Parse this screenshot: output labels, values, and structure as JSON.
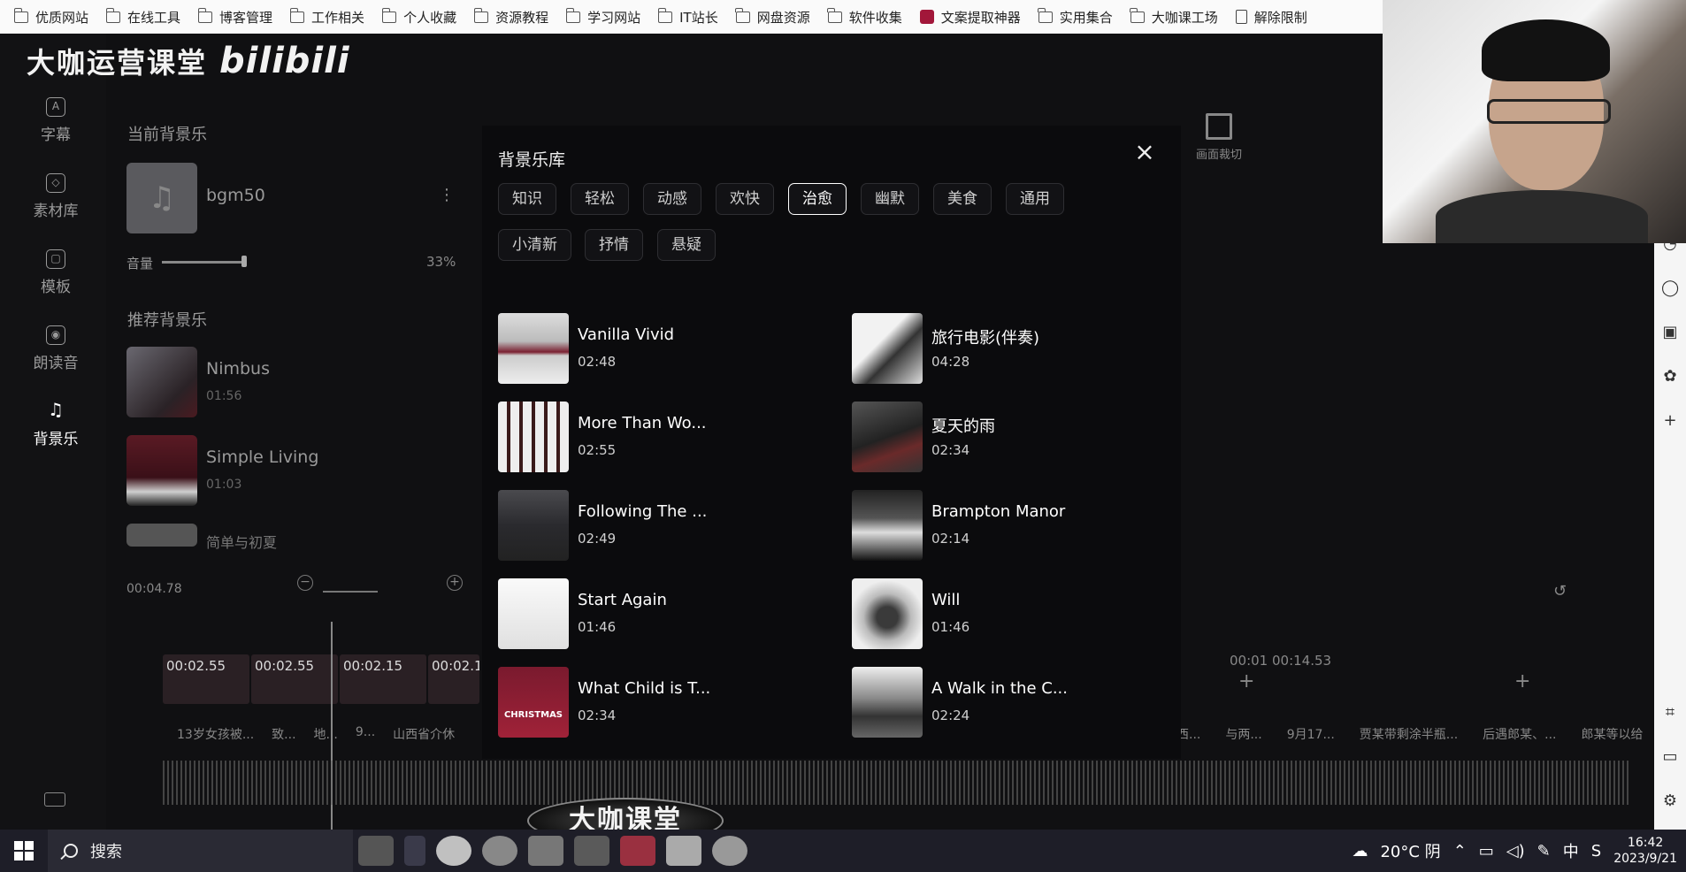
{
  "bookmarks": [
    {
      "label": "优质网站",
      "icon": "folder-icon"
    },
    {
      "label": "在线工具",
      "icon": "folder-icon"
    },
    {
      "label": "博客管理",
      "icon": "folder-icon"
    },
    {
      "label": "工作相关",
      "icon": "folder-icon"
    },
    {
      "label": "个人收藏",
      "icon": "folder-icon"
    },
    {
      "label": "资源教程",
      "icon": "folder-icon"
    },
    {
      "label": "学习网站",
      "icon": "folder-icon"
    },
    {
      "label": "IT站长",
      "icon": "folder-icon"
    },
    {
      "label": "网盘资源",
      "icon": "folder-icon"
    },
    {
      "label": "软件收集",
      "icon": "folder-icon"
    },
    {
      "label": "文案提取神器",
      "icon": "app-icon"
    },
    {
      "label": "实用集合",
      "icon": "folder-icon"
    },
    {
      "label": "大咖课工场",
      "icon": "folder-icon"
    },
    {
      "label": "解除限制",
      "icon": "document-icon"
    }
  ],
  "brand": {
    "text": "大咖运营课堂",
    "logo": "bilibili"
  },
  "rail": [
    {
      "label": "字幕",
      "icon": "A"
    },
    {
      "label": "素材库",
      "icon": "◇"
    },
    {
      "label": "模板",
      "icon": "▢"
    },
    {
      "label": "朗读音",
      "icon": "◉"
    },
    {
      "label": "背景乐",
      "icon": "♫"
    }
  ],
  "current_bgm": {
    "heading": "当前背景乐",
    "name": "bgm50",
    "volume_label": "音量",
    "volume_value": "33%",
    "volume": 0.33
  },
  "recommended": {
    "heading": "推荐背景乐",
    "items": [
      {
        "name": "Nimbus",
        "duration": "01:56"
      },
      {
        "name": "Simple Living",
        "duration": "01:03"
      },
      {
        "name": "简单与初夏",
        "duration": ""
      }
    ]
  },
  "timeline": {
    "time": "00:04.78",
    "clips": [
      "00:02.55",
      "00:02.55",
      "00:02.15",
      "00:02.1"
    ],
    "clip_labels": [
      "13岁女孩被...",
      "致...",
      "地...",
      "9...",
      "山西省介休"
    ],
    "right_times": "00:01  00:14.53",
    "right_labels": [
      "西...",
      "与两...",
      "9月17...",
      "贾某带剩涂半瓶...",
      "后遇郎某、...",
      "郎某等以给"
    ]
  },
  "crop": {
    "label": "画面裁切"
  },
  "modal": {
    "title": "背景乐库",
    "tags_row1": [
      "知识",
      "轻松",
      "动感",
      "欢快",
      "治愈",
      "幽默",
      "美食",
      "通用"
    ],
    "tags_row2": [
      "小清新",
      "抒情",
      "悬疑"
    ],
    "active_tag": "治愈",
    "tracks": [
      {
        "name": "Vanilla Vivid",
        "duration": "02:48"
      },
      {
        "name": "旅行电影(伴奏)",
        "duration": "04:28"
      },
      {
        "name": "More Than Wo...",
        "duration": "02:55"
      },
      {
        "name": "夏天的雨",
        "duration": "02:34"
      },
      {
        "name": "Following The ...",
        "duration": "02:49"
      },
      {
        "name": "Brampton Manor",
        "duration": "02:14"
      },
      {
        "name": "Start Again",
        "duration": "01:46"
      },
      {
        "name": "Will",
        "duration": "01:46"
      },
      {
        "name": "What Child is T...",
        "duration": "02:34"
      },
      {
        "name": "A Walk in the C...",
        "duration": "02:24"
      }
    ],
    "album_text": "CHRISTMAS"
  },
  "watermark": "大咖课堂",
  "taskbar": {
    "search": "搜索",
    "weather": "20°C 阴",
    "ime": "中",
    "time": "16:42",
    "date": "2023/9/21"
  }
}
